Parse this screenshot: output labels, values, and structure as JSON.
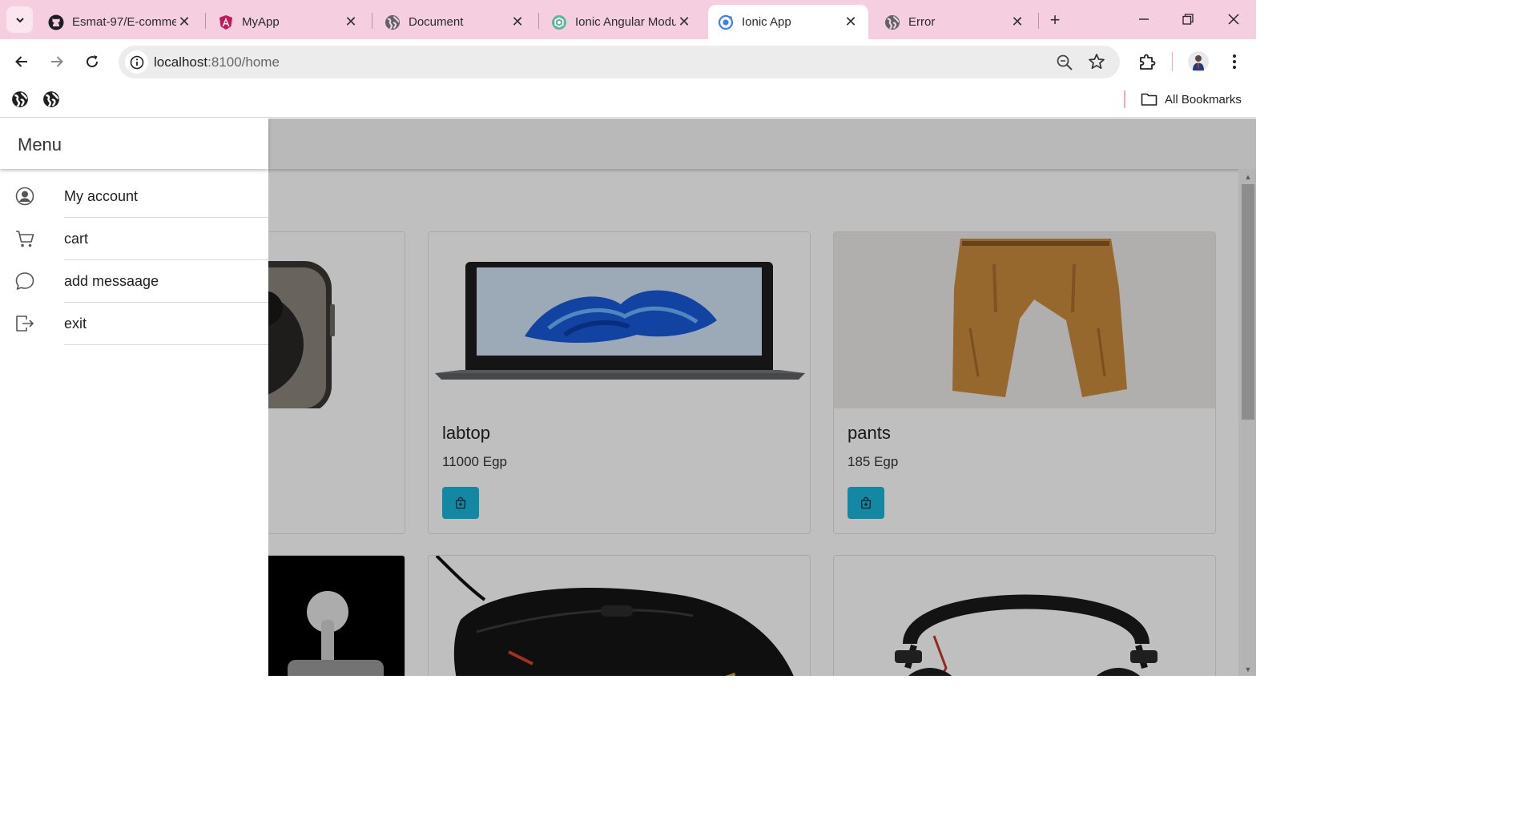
{
  "browser": {
    "tabs": [
      {
        "title": "Esmat-97/E-commerce",
        "icon": "github-icon"
      },
      {
        "title": "MyApp",
        "icon": "angular-icon"
      },
      {
        "title": "Document",
        "icon": "globe-icon"
      },
      {
        "title": "Ionic Angular Module",
        "icon": "chatgpt-icon"
      },
      {
        "title": "Ionic App",
        "icon": "ionic-icon",
        "active": true
      },
      {
        "title": "Error",
        "icon": "globe-icon"
      }
    ],
    "tab_close_glyph": "✕",
    "new_tab_glyph": "+",
    "url": {
      "host": "localhost",
      "path": ":8100/home"
    },
    "bookmarks": {
      "all_label": "All Bookmarks"
    }
  },
  "app": {
    "menu": {
      "title": "Menu",
      "items": [
        {
          "label": "My account",
          "icon": "person-circle-icon"
        },
        {
          "label": "cart",
          "icon": "cart-icon"
        },
        {
          "label": "add messaage",
          "icon": "chat-bubble-icon"
        },
        {
          "label": "exit",
          "icon": "exit-icon"
        }
      ]
    },
    "products": [
      {
        "name": "labtop",
        "price": "11000 Egp"
      },
      {
        "name": "pants",
        "price": "185 Egp"
      }
    ],
    "colors": {
      "accent": "#1ab6d8",
      "tabbar": "#f5cfe0"
    }
  }
}
